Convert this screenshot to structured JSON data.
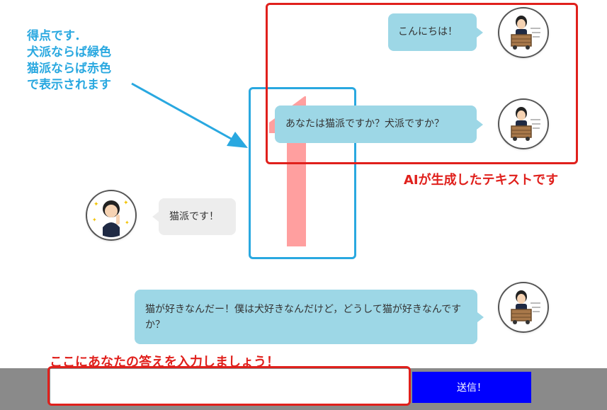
{
  "score": {
    "value": "1",
    "color": "#ff9a9a"
  },
  "annotations": {
    "score_note": [
      "得点です．",
      "犬派ならば緑色",
      "猫派ならば赤色",
      "で表示されます"
    ],
    "ai_generated": "AIが生成したテキストです",
    "input_prompt": "ここにあなたの答えを入力しましょう！"
  },
  "messages": {
    "greeting": "こんにちは！",
    "question": "あなたは猫派ですか？犬派ですか？",
    "user_answer": "猫派です！",
    "followup": "猫が好きなんだー！僕は犬好きなんだけど，どうして猫が好きなんですか？"
  },
  "input": {
    "value": "",
    "placeholder": ""
  },
  "send_button": {
    "label": "送信！"
  },
  "colors": {
    "ai_bubble": "#9dd7e6",
    "user_bubble": "#ededed",
    "annotation_blue": "#29a8e0",
    "annotation_red": "#e0201c",
    "send_button": "#0000ff",
    "bottom_bar": "#8a8a8a"
  },
  "icons": {
    "ai_avatar": "businesswoman-in-cart-icon",
    "user_avatar": "woman-pointing-icon"
  }
}
